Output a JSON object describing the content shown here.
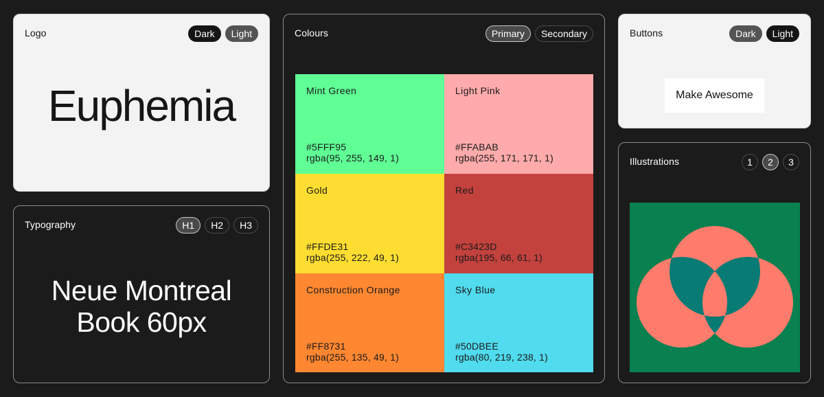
{
  "logo": {
    "title": "Logo",
    "options": [
      "Dark",
      "Light"
    ],
    "wordmark": "Euphemia"
  },
  "typography": {
    "title": "Typography",
    "options": [
      "H1",
      "H2",
      "H3"
    ],
    "sample_line1": "Neue Montreal",
    "sample_line2": "Book 60px"
  },
  "colours": {
    "title": "Colours",
    "options": [
      "Primary",
      "Secondary"
    ],
    "swatches": [
      {
        "name": "Mint Green",
        "hex": "#5FFF95",
        "rgba": "rgba(95, 255, 149, 1)"
      },
      {
        "name": "Light Pink",
        "hex": "#FFABAB",
        "rgba": "rgba(255, 171, 171, 1)"
      },
      {
        "name": "Gold",
        "hex": "#FFDE31",
        "rgba": "rgba(255, 222, 49, 1)"
      },
      {
        "name": "Red",
        "hex": "#C3423D",
        "rgba": "rgba(195, 66, 61, 1)"
      },
      {
        "name": "Construction Orange",
        "hex": "#FF8731",
        "rgba": "rgba(255, 135, 49, 1)"
      },
      {
        "name": "Sky Blue",
        "hex": "#50DBEE",
        "rgba": "rgba(80, 219, 238, 1)"
      }
    ]
  },
  "buttons": {
    "title": "Buttons",
    "options": [
      "Dark",
      "Light"
    ],
    "demo_label": "Make Awesome"
  },
  "illustrations": {
    "title": "Illustrations",
    "options": [
      "1",
      "2",
      "3"
    ],
    "colors": {
      "background": "#08804F",
      "coral": "#FF7B6B",
      "teal": "#087B74"
    }
  }
}
